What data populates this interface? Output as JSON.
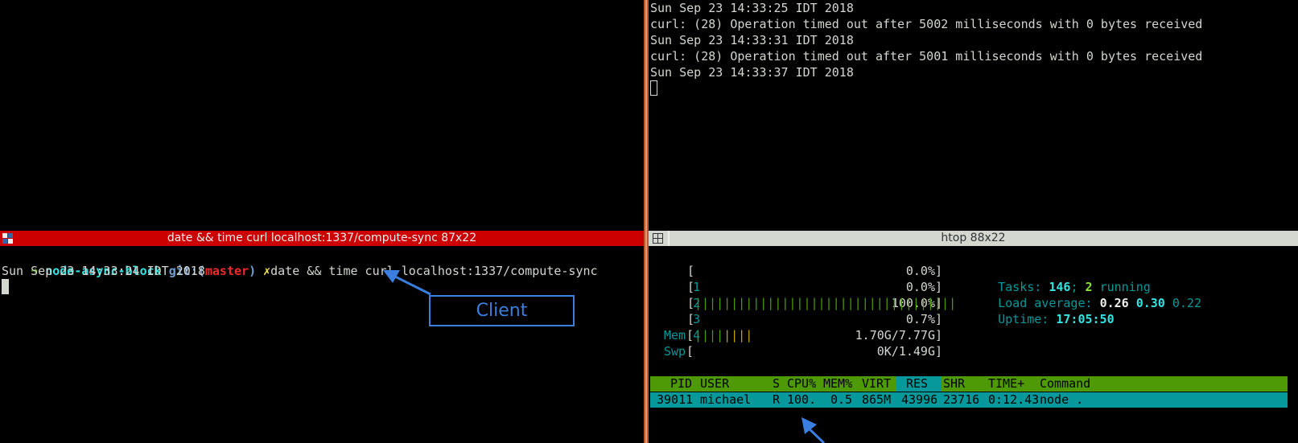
{
  "top_right_pane": {
    "lines": [
      "Sun Sep 23 14:33:25 IDT 2018",
      "curl: (28) Operation timed out after 5002 milliseconds with 0 bytes received",
      "Sun Sep 23 14:33:31 IDT 2018",
      "curl: (28) Operation timed out after 5001 milliseconds with 0 bytes received",
      "Sun Sep 23 14:33:37 IDT 2018"
    ]
  },
  "left_pane": {
    "title": "date && time curl localhost:1337/compute-sync 87x22",
    "prompt_arrow": "➜",
    "prompt_dir": "node-async-block",
    "prompt_git": "git:(",
    "prompt_branch": "master",
    "prompt_git_close": ")",
    "prompt_dirty": "✗",
    "command": "date && time curl localhost:1337/compute-sync",
    "output": "Sun Sep 23 14:33:24 IDT 2018",
    "annotation_label": "Client"
  },
  "htop_pane": {
    "title": "htop 88x22",
    "cpus": [
      {
        "num": "1",
        "value": "0.0%",
        "fraction": 0.0
      },
      {
        "num": "2",
        "value": "0.0%",
        "fraction": 0.0
      },
      {
        "num": "3",
        "value": "100.0%",
        "fraction": 1.0
      },
      {
        "num": "4",
        "value": "0.7%",
        "fraction": 0.007
      }
    ],
    "mem": {
      "label": "Mem",
      "value": "1.70G/7.77G",
      "fraction": 0.22
    },
    "swp": {
      "label": "Swp",
      "value": "0K/1.49G",
      "fraction": 0.0
    },
    "tasks_label": "Tasks:",
    "tasks_count": "146",
    "tasks_sep": ";",
    "tasks_running": "2",
    "tasks_running_label": "running",
    "load_label": "Load average:",
    "load1": "0.26",
    "load5": "0.30",
    "load15": "0.22",
    "uptime_label": "Uptime:",
    "uptime": "17:05:50",
    "columns": [
      "PID",
      "USER",
      "S",
      "CPU%",
      "MEM%",
      "VIRT",
      "RES",
      "SHR",
      "TIME+",
      "Command"
    ],
    "process": {
      "pid": "39011",
      "user": "michael",
      "state": "R",
      "cpu": "100.",
      "mem": "0.5",
      "virt": "865M",
      "res": "43996",
      "shr": "23716",
      "time": "0:12.43",
      "command": "node ."
    }
  },
  "colors": {
    "left_title_bg": "#cc0000",
    "right_title_bg": "#d3d7cf",
    "divider": "#c0582a",
    "header_bg": "#4e9a06",
    "selected_row_bg": "#06989a",
    "annotation_blue": "#3a7fe0"
  }
}
